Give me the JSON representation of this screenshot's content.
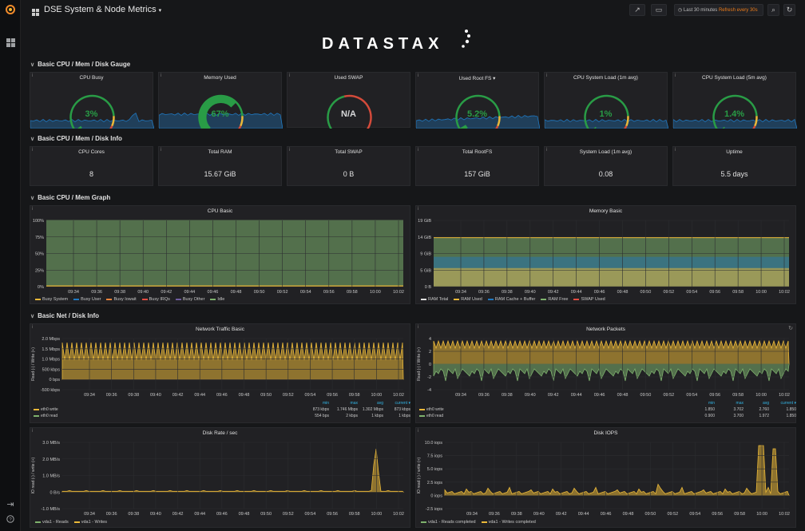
{
  "app": {
    "dashboard_title": "DSE System & Node Metrics",
    "time_range": "Last 30 minutes",
    "refresh": "Refresh every 30s",
    "logo_text": "DATASTAX"
  },
  "colors": {
    "green": "#299c46",
    "red": "#d44a3a",
    "orange": "#ed8128",
    "yellow_fill": "#cca300",
    "blue": "#1f78c1"
  },
  "rows": {
    "gauge": "Basic CPU / Mem / Disk Gauge",
    "info": "Basic CPU / Mem / Disk Info",
    "graph": "Basic CPU / Mem Graph",
    "net": "Basic Net / Disk Info"
  },
  "gauges": [
    {
      "title": "CPU Busy",
      "value": "3%",
      "percent": 3,
      "color": "#299c46"
    },
    {
      "title": "Memory Used",
      "value": "67%",
      "percent": 67,
      "color": "#299c46"
    },
    {
      "title": "Used SWAP",
      "value": "N/A",
      "percent": 0,
      "color": "#d8d9da"
    },
    {
      "title": "Used Root FS",
      "value": "5.2%",
      "percent": 5.2,
      "color": "#299c46"
    },
    {
      "title": "CPU System Load (1m avg)",
      "value": "1%",
      "percent": 1,
      "color": "#299c46"
    },
    {
      "title": "CPU System Load (5m avg)",
      "value": "1.4%",
      "percent": 1.4,
      "color": "#299c46"
    }
  ],
  "stats": [
    {
      "title": "CPU Cores",
      "value": "8"
    },
    {
      "title": "Total RAM",
      "value": "15.67 GiB"
    },
    {
      "title": "Total SWAP",
      "value": "0 B"
    },
    {
      "title": "Total RootFS",
      "value": "157 GiB"
    },
    {
      "title": "System Load (1m avg)",
      "value": "0.08"
    },
    {
      "title": "Uptime",
      "value": "5.5 days"
    }
  ],
  "time_ticks": [
    "09:34",
    "09:36",
    "09:38",
    "09:40",
    "09:42",
    "09:44",
    "09:46",
    "09:48",
    "09:50",
    "09:52",
    "09:54",
    "09:56",
    "09:58",
    "10:00",
    "10:02"
  ],
  "cpu_basic": {
    "title": "CPU Basic",
    "y_ticks": [
      "100%",
      "75%",
      "50%",
      "25%",
      "0%"
    ],
    "legend": [
      {
        "name": "Busy System",
        "color": "#eab839"
      },
      {
        "name": "Busy User",
        "color": "#1f78c1"
      },
      {
        "name": "Busy Iowait",
        "color": "#ef843c"
      },
      {
        "name": "Busy IRQs",
        "color": "#e24d42"
      },
      {
        "name": "Busy Other",
        "color": "#705da0"
      },
      {
        "name": "Idle",
        "color": "#7eb26d"
      }
    ]
  },
  "memory_basic": {
    "title": "Memory Basic",
    "y_ticks": [
      "19 GiB",
      "14 GiB",
      "9 GiB",
      "5 GiB",
      "0 B"
    ],
    "legend": [
      {
        "name": "RAM Total",
        "color": "#e0e0e0"
      },
      {
        "name": "RAM Used",
        "color": "#eab839"
      },
      {
        "name": "RAM Cache + Buffer",
        "color": "#1f78c1"
      },
      {
        "name": "RAM Free",
        "color": "#7eb26d"
      },
      {
        "name": "SWAP Used",
        "color": "#e24d42"
      }
    ]
  },
  "network_traffic": {
    "title": "Network Traffic Basic",
    "y_axis_label": "Read (-) / Write (+)",
    "y_ticks": [
      "2.0 Mbps",
      "1.5 Mbps",
      "1.0 Mbps",
      "500 kbps",
      "0 bps",
      "-500 kbps"
    ],
    "columns": [
      "min",
      "max",
      "avg",
      "current"
    ],
    "series": [
      {
        "name": "eth0 write",
        "color": "#eab839",
        "min": "873 kbps",
        "max": "1.746 Mbps",
        "avg": "1.302 Mbps",
        "current": "873 kbps"
      },
      {
        "name": "eth0 read",
        "color": "#7eb26d",
        "min": "554 bps",
        "max": "2 kbps",
        "avg": "1 kbps",
        "current": "1 kbps"
      }
    ]
  },
  "network_packets": {
    "title": "Network Packets",
    "y_axis_label": "Read (-) / Write (+)",
    "y_ticks": [
      "4",
      "2",
      "0",
      "-2",
      "-4"
    ],
    "columns": [
      "min",
      "max",
      "avg",
      "current"
    ],
    "series": [
      {
        "name": "eth0 write",
        "color": "#eab839",
        "min": "1.850",
        "max": "3.702",
        "avg": "2.760",
        "current": "1.850"
      },
      {
        "name": "eth0 read",
        "color": "#7eb26d",
        "min": "0.900",
        "max": "3.700",
        "avg": "1.972",
        "current": "1.850"
      }
    ]
  },
  "disk_rate": {
    "title": "Disk Rate / sec",
    "y_axis_label": "IO read (-) / write (+)",
    "y_ticks": [
      "3.0 MB/s",
      "2.0 MB/s",
      "1.0 MB/s",
      "0 B/s",
      "-1.0 MB/s"
    ],
    "legend": [
      {
        "name": "vda1 - Reads",
        "color": "#7eb26d"
      },
      {
        "name": "vda1 - Writes",
        "color": "#eab839"
      }
    ]
  },
  "disk_iops": {
    "title": "Disk IOPS",
    "y_axis_label": "IO read (-) / write (+)",
    "y_ticks": [
      "10.0 iops",
      "7.5 iops",
      "5.0 iops",
      "2.5 iops",
      "0 iops",
      "-2.5 iops"
    ],
    "legend": [
      {
        "name": "vda1 - Reads completed",
        "color": "#7eb26d"
      },
      {
        "name": "vda1 - Writes completed",
        "color": "#eab839"
      }
    ]
  }
}
